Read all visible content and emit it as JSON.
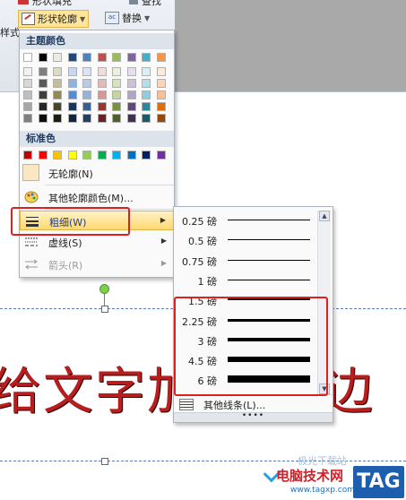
{
  "ribbon": {
    "shape_fill_label": "形状填充",
    "find_label": "查找",
    "style_label": "样式",
    "shape_outline_label": "形状轮廓",
    "replace_label": "替换"
  },
  "menu": {
    "theme_colors_header": "主题颜色",
    "standard_colors_header": "标准色",
    "no_outline_label": "无轮廓(N)",
    "more_colors_label": "其他轮廓颜色(M)...",
    "weight_label": "粗细(W)",
    "dashes_label": "虚线(S)",
    "arrows_label": "箭头(R)",
    "theme_colors_top": [
      "#ffffff",
      "#000000",
      "#eeece1",
      "#1f497d",
      "#4f81bd",
      "#c0504d",
      "#9bbb59",
      "#8064a2",
      "#4bacc6",
      "#f79646"
    ],
    "theme_colors_shades": [
      [
        "#f2f2f2",
        "#7f7f7f",
        "#ddd9c3",
        "#c6d9f0",
        "#dbe5f1",
        "#f2dcdb",
        "#ebf1dd",
        "#e5e0ec",
        "#dbeef3",
        "#fdeada"
      ],
      [
        "#d8d8d8",
        "#595959",
        "#c4bd97",
        "#8db3e2",
        "#b8cce4",
        "#e5b9b7",
        "#d7e3bc",
        "#ccc1d9",
        "#b7dde8",
        "#fbd5b5"
      ],
      [
        "#bfbfbf",
        "#3f3f3f",
        "#938953",
        "#548dd4",
        "#95b3d7",
        "#d99694",
        "#c3d69b",
        "#b2a2c7",
        "#92cddc",
        "#fac08f"
      ],
      [
        "#a5a5a5",
        "#262626",
        "#494429",
        "#17365d",
        "#366092",
        "#953734",
        "#76923c",
        "#5f497a",
        "#31859b",
        "#e36c09"
      ],
      [
        "#7f7f7f",
        "#0c0c0c",
        "#1d1b10",
        "#0f243e",
        "#244061",
        "#632423",
        "#4f6128",
        "#3f3151",
        "#205867",
        "#974806"
      ]
    ],
    "standard_colors": [
      "#c00000",
      "#ff0000",
      "#ffc000",
      "#ffff00",
      "#92d050",
      "#00b050",
      "#00b0f0",
      "#0070c0",
      "#002060",
      "#7030a0"
    ]
  },
  "submenu": {
    "weights": [
      {
        "label": "0.25 磅",
        "pt": 0.25
      },
      {
        "label": "0.5 磅",
        "pt": 0.5
      },
      {
        "label": "0.75 磅",
        "pt": 0.75
      },
      {
        "label": "1 磅",
        "pt": 1
      },
      {
        "label": "1.5 磅",
        "pt": 1.5
      },
      {
        "label": "2.25 磅",
        "pt": 2.25
      },
      {
        "label": "3 磅",
        "pt": 3
      },
      {
        "label": "4.5 磅",
        "pt": 4.5
      },
      {
        "label": "6 磅",
        "pt": 6
      }
    ],
    "more_lines_label": "其他线条(L)...",
    "grip": "••••"
  },
  "document": {
    "text_left": "给文字加",
    "text_right": "边"
  },
  "watermark": {
    "site_name": "电脑技术网",
    "url": "www.tagxp.com",
    "tag": "TAG",
    "faded_text": "极光下载站"
  },
  "colors": {
    "highlight_red": "#e02020",
    "doc_text_red": "#b81e1e",
    "menu_selected": "#ffd970"
  }
}
